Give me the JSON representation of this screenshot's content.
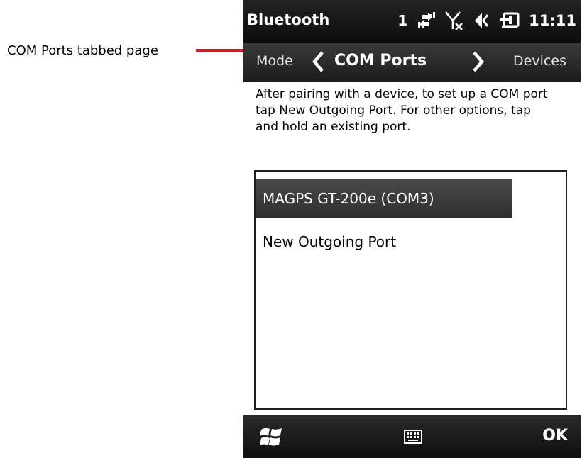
{
  "annotation": {
    "text": "COM Ports tabbed page",
    "color": "#e8121a"
  },
  "status_bar": {
    "title": "Bluetooth",
    "signal_count": "1",
    "time": "11:11",
    "icons": [
      "data-sync-icon",
      "no-signal-antenna-icon",
      "volume-icon",
      "power-plug-icon"
    ]
  },
  "tabs": {
    "previous": "Mode",
    "current": "COM Ports",
    "next": "Devices"
  },
  "content": {
    "instructions": "After pairing with a device, to set up a COM port tap New Outgoing Port. For other options, tap and hold an existing port.",
    "ports": [
      {
        "label": "MAGPS GT-200e (COM3)",
        "selected": true
      },
      {
        "label": "New Outgoing Port",
        "selected": false
      }
    ]
  },
  "bottom_bar": {
    "ok_label": "OK",
    "icons": [
      "windows-start-icon",
      "keyboard-icon"
    ]
  }
}
